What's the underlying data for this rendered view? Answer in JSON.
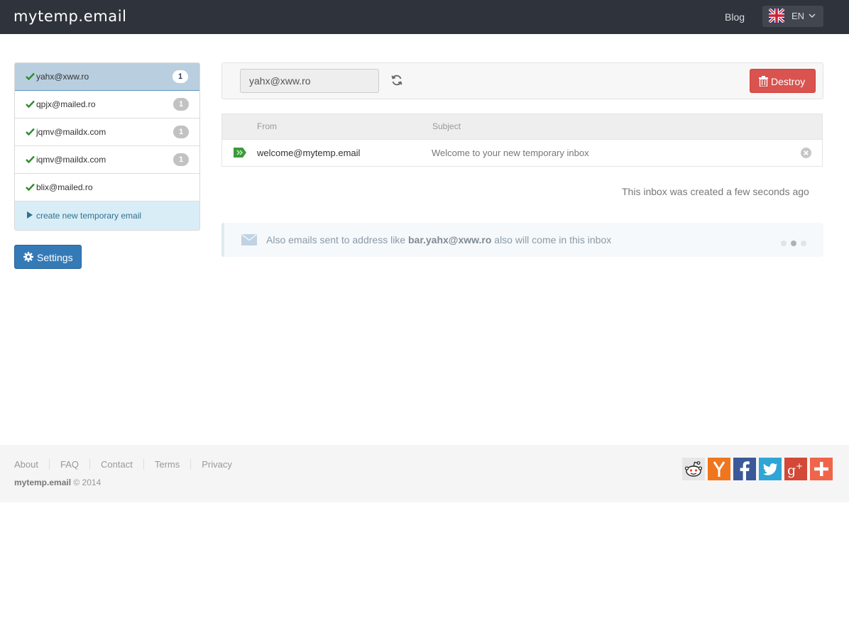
{
  "header": {
    "brand": "mytemp.email",
    "blog_link": "Blog",
    "language_code": "EN",
    "icons": {
      "flag": "uk-flag-icon",
      "dropdown": "chevron-down-icon"
    }
  },
  "sidebar": {
    "emails": [
      {
        "address": "yahx@xww.ro",
        "count": "1",
        "active": true
      },
      {
        "address": "qpjx@mailed.ro",
        "count": "1",
        "active": false
      },
      {
        "address": "jqmv@maildx.com",
        "count": "1",
        "active": false
      },
      {
        "address": "iqmv@maildx.com",
        "count": "1",
        "active": false
      },
      {
        "address": "blix@mailed.ro",
        "count": "",
        "active": false
      }
    ],
    "create_label": "create new temporary email",
    "settings_label": "Settings"
  },
  "toolbar": {
    "address_value": "yahx@xww.ro",
    "destroy_label": "Destroy"
  },
  "inbox": {
    "columns": {
      "from": "From",
      "subject": "Subject"
    },
    "rows": [
      {
        "from": "welcome@mytemp.email",
        "subject": "Welcome to your new temporary inbox"
      }
    ],
    "created_text": "This inbox was created a few seconds ago"
  },
  "alert": {
    "prefix": "Also emails sent to address like ",
    "example": "bar.yahx@xww.ro",
    "suffix": " also will come in this inbox",
    "active_dot": 2
  },
  "footer": {
    "links": [
      "About",
      "FAQ",
      "Contact",
      "Terms",
      "Privacy"
    ],
    "brand": "mytemp.email",
    "copyright": " © 2014",
    "social": [
      "reddit-icon",
      "hacker-news-icon",
      "facebook-icon",
      "twitter-icon",
      "google-plus-icon",
      "add-share-icon"
    ]
  },
  "colors": {
    "navbar": "#2f333b",
    "primary": "#337ab7",
    "danger": "#d9534f",
    "success": "#3c9a3c",
    "info_bg": "#d9edf7"
  }
}
